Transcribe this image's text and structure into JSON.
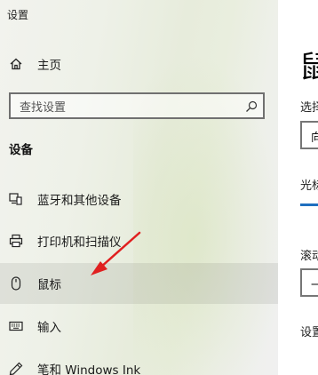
{
  "window": {
    "title": "设置"
  },
  "sidebar": {
    "home_label": "主页",
    "search_placeholder": "查找设置",
    "section_heading": "设备",
    "items": [
      {
        "label": "蓝牙和其他设备",
        "icon": "bluetooth-devices-icon"
      },
      {
        "label": "打印机和扫描仪",
        "icon": "printer-icon"
      },
      {
        "label": "鼠标",
        "icon": "mouse-icon",
        "selected": true
      },
      {
        "label": "输入",
        "icon": "keyboard-icon"
      },
      {
        "label": "笔和 Windows Ink",
        "icon": "pen-icon"
      }
    ]
  },
  "main": {
    "title": "鼠",
    "label_1": "选择",
    "select_1_value": "向",
    "label_2": "光标",
    "label_3": "滚动",
    "select_2_value": "一",
    "label_4": "设置"
  },
  "colors": {
    "accent": "#1f6fbf",
    "annotation_arrow": "#e02020"
  }
}
